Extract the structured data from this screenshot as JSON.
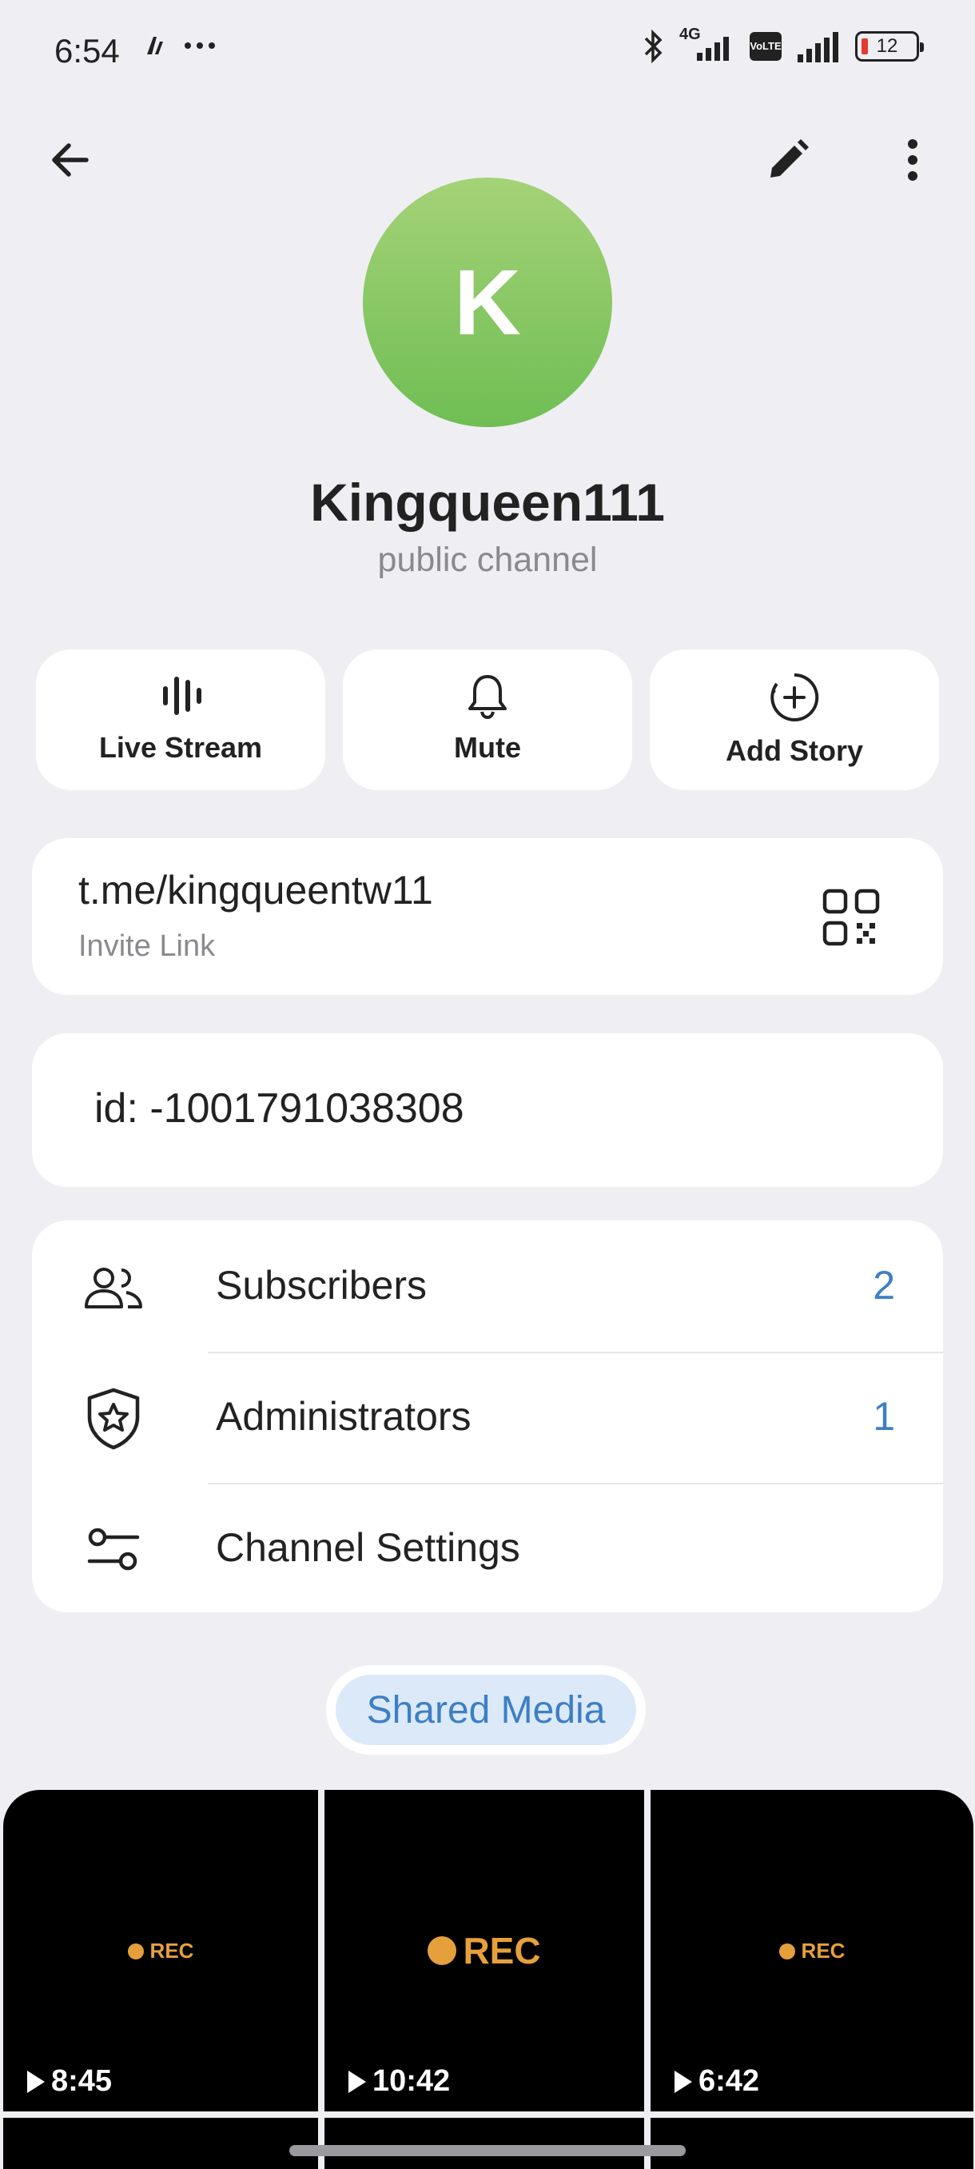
{
  "status_bar": {
    "time": "6:54",
    "network_label": "4G",
    "volte_label": "VoLTE",
    "battery_level": "12"
  },
  "topbar": {
    "back_icon": "arrow-left-icon",
    "edit_icon": "pencil-icon",
    "more_icon": "more-vertical-icon"
  },
  "profile": {
    "avatar_letter": "K",
    "avatar_color_top": "#a5d277",
    "avatar_color_bottom": "#6fbe54",
    "name": "Kingqueen111",
    "type": "public channel"
  },
  "actions": [
    {
      "label": "Live Stream",
      "icon": "live-stream-icon"
    },
    {
      "label": "Mute",
      "icon": "bell-icon"
    },
    {
      "label": "Add Story",
      "icon": "add-story-icon"
    }
  ],
  "invite": {
    "link": "t.me/kingqueentw11",
    "label": "Invite Link",
    "icon": "qr-code-icon"
  },
  "channel_id": "id: -1001791038308",
  "list": [
    {
      "label": "Subscribers",
      "value": "2",
      "icon": "users-icon"
    },
    {
      "label": "Administrators",
      "value": "1",
      "icon": "shield-star-icon"
    },
    {
      "label": "Channel Settings",
      "value": "",
      "icon": "sliders-icon"
    }
  ],
  "shared_media": {
    "label": "Shared Media",
    "accent": "#3d7fc4",
    "tiles": [
      {
        "rec": "REC",
        "duration": "8:45"
      },
      {
        "rec": "REC",
        "duration": "10:42"
      },
      {
        "rec": "REC",
        "duration": "6:42"
      }
    ]
  }
}
